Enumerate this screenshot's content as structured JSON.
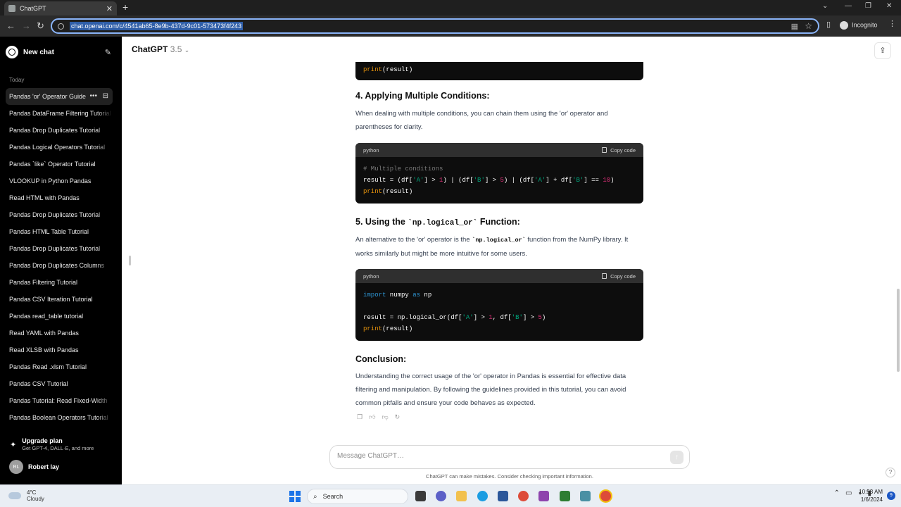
{
  "browser": {
    "tab_title": "ChatGPT",
    "url": "chat.openai.com/c/4541ab65-8e9b-437d-9c01-573473f4f243",
    "profile_label": "Incognito"
  },
  "sidebar": {
    "new_chat": "New chat",
    "section_today": "Today",
    "items": [
      {
        "label": "Pandas 'or' Operator Guide"
      },
      {
        "label": "Pandas DataFrame Filtering Tutorial"
      },
      {
        "label": "Pandas Drop Duplicates Tutorial"
      },
      {
        "label": "Pandas Logical Operators Tutorial"
      },
      {
        "label": "Pandas `like` Operator Tutorial"
      },
      {
        "label": "VLOOKUP in Python Pandas"
      },
      {
        "label": "Read HTML with Pandas"
      },
      {
        "label": "Pandas Drop Duplicates Tutorial"
      },
      {
        "label": "Pandas HTML Table Tutorial"
      },
      {
        "label": "Pandas Drop Duplicates Tutorial"
      },
      {
        "label": "Pandas Drop Duplicates Columns"
      },
      {
        "label": "Pandas Filtering Tutorial"
      },
      {
        "label": "Pandas CSV Iteration Tutorial"
      },
      {
        "label": "Pandas read_table tutorial"
      },
      {
        "label": "Read YAML with Pandas"
      },
      {
        "label": "Read XLSB with Pandas"
      },
      {
        "label": "Pandas Read .xlsm Tutorial"
      },
      {
        "label": "Pandas CSV Tutorial"
      },
      {
        "label": "Pandas Tutorial: Read Fixed-Width"
      },
      {
        "label": "Pandas Boolean Operators Tutorial"
      }
    ],
    "upgrade_title": "Upgrade plan",
    "upgrade_sub": "Get GPT-4, DALL·E, and more",
    "user_initials": "RL",
    "user_name": "Robert lay"
  },
  "header": {
    "model_name": "ChatGPT",
    "model_version": "3.5"
  },
  "content": {
    "section4_title": "4. Applying Multiple Conditions:",
    "section4_para": "When dealing with multiple conditions, you can chain them using the 'or' operator and parentheses for clarity.",
    "section5_prefix": "5. Using the ",
    "section5_code": "`np.logical_or`",
    "section5_suffix": " Function:",
    "section5_p1": "An alternative to the 'or' operator is the ",
    "section5_p_code": "`np.logical_or`",
    "section5_p2": " function from the NumPy library. It works similarly but might be more intuitive for some users.",
    "conclusion_title": "Conclusion:",
    "conclusion_para": "Understanding the correct usage of the 'or' operator in Pandas is essential for effective data filtering and manipulation. By following the guidelines provided in this tutorial, you can avoid common pitfalls and ensure your code behaves as expected.",
    "code_lang": "python",
    "copy_label": "Copy code"
  },
  "composer": {
    "placeholder": "Message ChatGPT…",
    "disclaimer": "ChatGPT can make mistakes. Consider checking important information."
  },
  "taskbar": {
    "temp": "4°C",
    "condition": "Cloudy",
    "search": "Search",
    "time": "10:53 AM",
    "date": "1/6/2024",
    "notifications": "9"
  },
  "colors": {
    "sidebar_bg": "#000000",
    "code_bg": "#0d0d0d",
    "code_header": "#2f2f2f",
    "keyword": "#2e95d3",
    "string": "#00a67d",
    "number": "#df3079",
    "builtin": "#e9950c"
  }
}
